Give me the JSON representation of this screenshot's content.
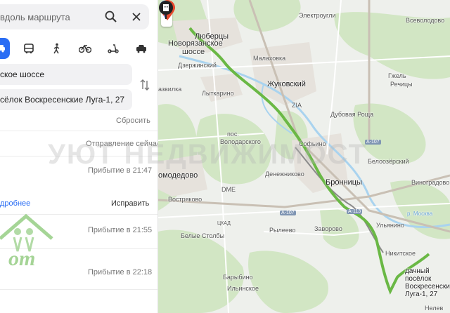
{
  "search": {
    "text": "вдоль маршрута"
  },
  "modes": [
    "car-icon",
    "bus-icon",
    "walk-icon",
    "bike-icon",
    "scooter-icon",
    "taxi-icon"
  ],
  "route": {
    "from": "ское шоссе",
    "to": "сёлок Воскресенские Луга-1, 27",
    "reset": "Сбросить",
    "depart": "Отправление сейчас"
  },
  "options": [
    {
      "arrival": "Прибытие в 21:47"
    },
    {
      "arrival": "Прибытие в 21:55"
    },
    {
      "arrival": "Прибытие в 22:18"
    }
  ],
  "links": {
    "more": "дробнее",
    "fix": "Исправить"
  },
  "map": {
    "labels": {
      "lyubertsy": "Люберцы",
      "novoryazanskoe": "Новорязанское",
      "shosse": "шоссе",
      "elektrougli": "Электроугли",
      "vsevolodovo": "Всеволодово",
      "malakhovka": "Малаховка",
      "dzerzhinsky": "Дзержинский",
      "zhukovsky": "Жуковский",
      "gzhel": "Гжель",
      "rechitsy": "Речицы",
      "zavidnaya": "азвилка",
      "lytkarino": "Лыткарино",
      "zia": "ZIA",
      "dubovaya": "Дубовая Роща",
      "sofyino": "Софьино",
      "volodarskogo1": "пос.",
      "volodarskogo2": "Володарского",
      "belozersky": "Белоозёрский",
      "denezhnikovo": "Денежниково",
      "bronnitsy": "Бронницы",
      "domodedovo": "омодедово",
      "dme": "DME",
      "vinogradovo": "Виноградово",
      "vostryakovo": "Востряково",
      "ulyanino": "Ульянино",
      "belye": "Белые Столбы",
      "ryleevo": "Рылеево",
      "zavorovo": "Заворово",
      "nikitskoe": "Никитское",
      "barybino": "Барыбино",
      "ilinskoe": "Ильинское",
      "ne": "Нелев",
      "a107a": "А-107",
      "a107b": "А-107",
      "a113": "А-113",
      "tskad": "ЦКАД",
      "moskva": "р. Москва"
    },
    "destination": "дачный посёлок Воскресенские Луга-1, 27",
    "colors": {
      "route": "#6ab845",
      "alt_route": "#8a8a8a",
      "start_pin": "#e8492c",
      "mid_pin": "#2a6df4"
    }
  },
  "watermark": "УЮТ НЕДВИЖИМОСТ"
}
